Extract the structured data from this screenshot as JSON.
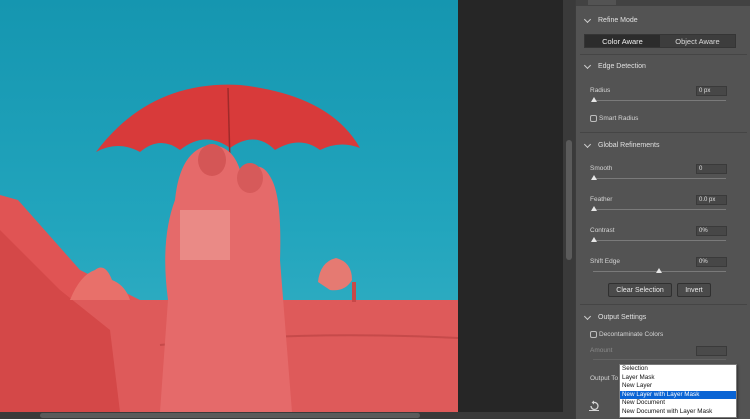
{
  "panel": {
    "refine_mode": {
      "title": "Refine Mode",
      "options": [
        "Color Aware",
        "Object Aware"
      ],
      "selected": "Color Aware"
    },
    "edge_detection": {
      "title": "Edge Detection",
      "radius_label": "Radius",
      "radius_value": "0 px",
      "smart_radius_label": "Smart Radius",
      "smart_radius_checked": false
    },
    "global_refinements": {
      "title": "Global Refinements",
      "smooth_label": "Smooth",
      "smooth_value": "0",
      "feather_label": "Feather",
      "feather_value": "0.0 px",
      "contrast_label": "Contrast",
      "contrast_value": "0%",
      "shift_edge_label": "Shift Edge",
      "shift_edge_value": "0%",
      "clear_selection_label": "Clear Selection",
      "invert_label": "Invert"
    },
    "output_settings": {
      "title": "Output Settings",
      "decontaminate_label": "Decontaminate Colors",
      "decontaminate_checked": false,
      "amount_label": "Amount",
      "output_to_label": "Output To",
      "output_options": [
        "Selection",
        "Layer Mask",
        "New Layer",
        "New Layer with Layer Mask",
        "New Document",
        "New Document with Layer Mask"
      ],
      "output_selected": "New Layer with Layer Mask"
    }
  },
  "icons": {
    "reset": "reset-arrow-icon"
  },
  "colors": {
    "overlay": "#e05252",
    "sky": "#1e9fb8",
    "dropdown_highlight": "#0a64d4",
    "panel_bg": "#535353"
  }
}
